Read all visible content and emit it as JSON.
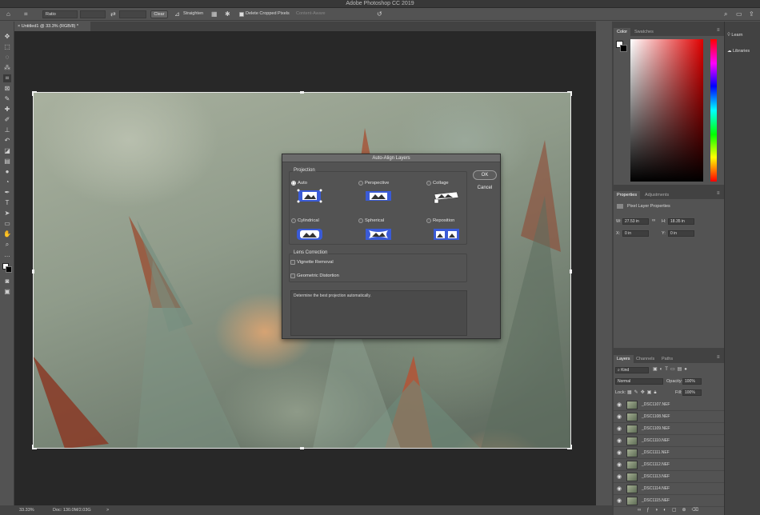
{
  "app": {
    "title": "Adobe Photoshop CC 2019"
  },
  "options_bar": {
    "ratio_label": "Ratio",
    "clear": "Clear",
    "straighten": "Straighten",
    "delete_cropped": "Delete Cropped Pixels",
    "content_aware": "Content-Aware"
  },
  "document": {
    "tab_label": "Untitled1 @ 33.3% (RGB/8) *"
  },
  "dialog": {
    "title": "Auto-Align Layers",
    "projection_label": "Projection",
    "options": [
      "Auto",
      "Perspective",
      "Collage",
      "Cylindrical",
      "Spherical",
      "Reposition"
    ],
    "selected": "Auto",
    "lens_label": "Lens Correction",
    "vignette": "Vignette Removal",
    "geometric": "Geometric Distortion",
    "ok": "OK",
    "cancel": "Cancel",
    "description": "Determine the best projection automatically."
  },
  "status": {
    "zoom": "33.33%",
    "doc": "Doc: 130.0M/2.03G",
    "arrow": ">"
  },
  "panels": {
    "color_tabs": [
      "Color",
      "Swatches"
    ],
    "props_tabs": [
      "Properties",
      "Adjustments"
    ],
    "props_title": "Pixel Layer Properties",
    "w_label": "W:",
    "w_value": "27.53 in",
    "h_label": "H:",
    "h_value": "18.35 in",
    "x_label": "X:",
    "x_value": "0 in",
    "y_label": "Y:",
    "y_value": "0 in",
    "layers_tabs": [
      "Layers",
      "Channels",
      "Paths"
    ],
    "kind": "Kind",
    "blend_mode": "Normal",
    "opacity_label": "Opacity:",
    "opacity_value": "100%",
    "lock_label": "Lock:",
    "fill_label": "Fill:",
    "fill_value": "100%",
    "layers": [
      "_DSC1107.NEF",
      "_DSC1108.NEF",
      "_DSC1109.NEF",
      "_DSC1110.NEF",
      "_DSC1111.NEF",
      "_DSC1112.NEF",
      "_DSC1113.NEF",
      "_DSC1114.NEF",
      "_DSC1115.NEF"
    ]
  },
  "right_rail": {
    "learn": "Learn",
    "libraries": "Libraries"
  }
}
